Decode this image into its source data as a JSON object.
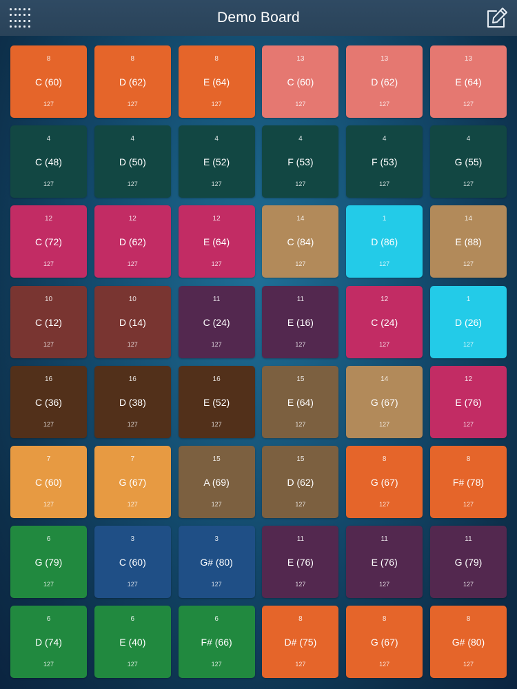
{
  "header": {
    "title": "Demo Board"
  },
  "icons": {
    "left": "grid-menu-icon",
    "right": "edit-icon"
  },
  "colors": {
    "orange": "#e5652a",
    "salmon": "#e57871",
    "teal": "#124743",
    "magenta": "#c22c64",
    "tan": "#b28a5a",
    "cyan": "#23cbe8",
    "brown": "#793531",
    "purple": "#53284f",
    "darkbrown": "#52301a",
    "olive": "#7c6040",
    "lightorange": "#e79a42",
    "green": "#21893f",
    "blue": "#1f4f86"
  },
  "pads": [
    {
      "ch": "8",
      "note": "C (60)",
      "vel": "127",
      "color": "orange"
    },
    {
      "ch": "8",
      "note": "D (62)",
      "vel": "127",
      "color": "orange"
    },
    {
      "ch": "8",
      "note": "E (64)",
      "vel": "127",
      "color": "orange"
    },
    {
      "ch": "13",
      "note": "C (60)",
      "vel": "127",
      "color": "salmon"
    },
    {
      "ch": "13",
      "note": "D (62)",
      "vel": "127",
      "color": "salmon"
    },
    {
      "ch": "13",
      "note": "E (64)",
      "vel": "127",
      "color": "salmon"
    },
    {
      "ch": "4",
      "note": "C (48)",
      "vel": "127",
      "color": "teal"
    },
    {
      "ch": "4",
      "note": "D (50)",
      "vel": "127",
      "color": "teal"
    },
    {
      "ch": "4",
      "note": "E (52)",
      "vel": "127",
      "color": "teal"
    },
    {
      "ch": "4",
      "note": "F (53)",
      "vel": "127",
      "color": "teal"
    },
    {
      "ch": "4",
      "note": "F (53)",
      "vel": "127",
      "color": "teal"
    },
    {
      "ch": "4",
      "note": "G (55)",
      "vel": "127",
      "color": "teal"
    },
    {
      "ch": "12",
      "note": "C (72)",
      "vel": "127",
      "color": "magenta"
    },
    {
      "ch": "12",
      "note": "D (62)",
      "vel": "127",
      "color": "magenta"
    },
    {
      "ch": "12",
      "note": "E (64)",
      "vel": "127",
      "color": "magenta"
    },
    {
      "ch": "14",
      "note": "C (84)",
      "vel": "127",
      "color": "tan"
    },
    {
      "ch": "1",
      "note": "D (86)",
      "vel": "127",
      "color": "cyan"
    },
    {
      "ch": "14",
      "note": "E (88)",
      "vel": "127",
      "color": "tan"
    },
    {
      "ch": "10",
      "note": "C (12)",
      "vel": "127",
      "color": "brown"
    },
    {
      "ch": "10",
      "note": "D (14)",
      "vel": "127",
      "color": "brown"
    },
    {
      "ch": "11",
      "note": "C (24)",
      "vel": "127",
      "color": "purple"
    },
    {
      "ch": "11",
      "note": "E (16)",
      "vel": "127",
      "color": "purple"
    },
    {
      "ch": "12",
      "note": "C (24)",
      "vel": "127",
      "color": "magenta"
    },
    {
      "ch": "1",
      "note": "D (26)",
      "vel": "127",
      "color": "cyan"
    },
    {
      "ch": "16",
      "note": "C (36)",
      "vel": "127",
      "color": "darkbrown"
    },
    {
      "ch": "16",
      "note": "D (38)",
      "vel": "127",
      "color": "darkbrown"
    },
    {
      "ch": "16",
      "note": "E (52)",
      "vel": "127",
      "color": "darkbrown"
    },
    {
      "ch": "15",
      "note": "E (64)",
      "vel": "127",
      "color": "olive"
    },
    {
      "ch": "14",
      "note": "G (67)",
      "vel": "127",
      "color": "tan"
    },
    {
      "ch": "12",
      "note": "E (76)",
      "vel": "127",
      "color": "magenta"
    },
    {
      "ch": "7",
      "note": "C (60)",
      "vel": "127",
      "color": "lightorange"
    },
    {
      "ch": "7",
      "note": "G (67)",
      "vel": "127",
      "color": "lightorange"
    },
    {
      "ch": "15",
      "note": "A (69)",
      "vel": "127",
      "color": "olive"
    },
    {
      "ch": "15",
      "note": "D (62)",
      "vel": "127",
      "color": "olive"
    },
    {
      "ch": "8",
      "note": "G (67)",
      "vel": "127",
      "color": "orange"
    },
    {
      "ch": "8",
      "note": "F# (78)",
      "vel": "127",
      "color": "orange"
    },
    {
      "ch": "6",
      "note": "G (79)",
      "vel": "127",
      "color": "green"
    },
    {
      "ch": "3",
      "note": "C (60)",
      "vel": "127",
      "color": "blue"
    },
    {
      "ch": "3",
      "note": "G# (80)",
      "vel": "127",
      "color": "blue"
    },
    {
      "ch": "11",
      "note": "E (76)",
      "vel": "127",
      "color": "purple"
    },
    {
      "ch": "11",
      "note": "E (76)",
      "vel": "127",
      "color": "purple"
    },
    {
      "ch": "11",
      "note": "G (79)",
      "vel": "127",
      "color": "purple"
    },
    {
      "ch": "6",
      "note": "D (74)",
      "vel": "127",
      "color": "green"
    },
    {
      "ch": "6",
      "note": "E (40)",
      "vel": "127",
      "color": "green"
    },
    {
      "ch": "6",
      "note": "F# (66)",
      "vel": "127",
      "color": "green"
    },
    {
      "ch": "8",
      "note": "D# (75)",
      "vel": "127",
      "color": "orange"
    },
    {
      "ch": "8",
      "note": "G (67)",
      "vel": "127",
      "color": "orange"
    },
    {
      "ch": "8",
      "note": "G# (80)",
      "vel": "127",
      "color": "orange"
    }
  ]
}
